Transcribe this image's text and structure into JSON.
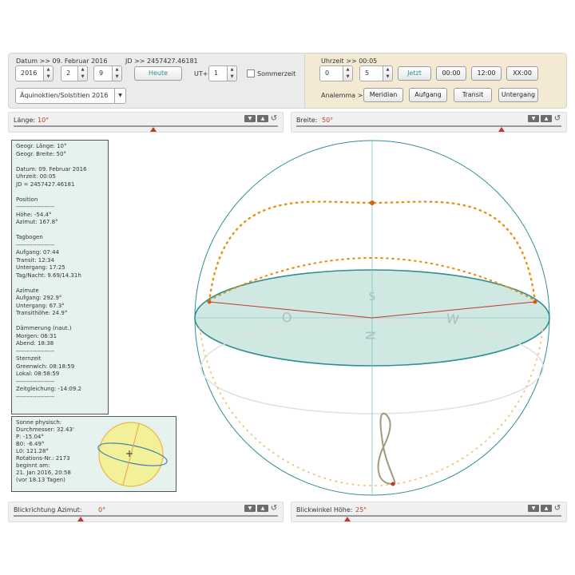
{
  "date_panel": {
    "datum_label": "Datum >> 09. Februar 2016",
    "jd_label": "JD >> 2457427.46181",
    "year": "2016",
    "month": "2",
    "day": "9",
    "today_button": "Heute",
    "ut_label": "UT+",
    "ut_value": "1",
    "dst_label": "Sommerzeit",
    "event_select": "Äquinoktien/Solstitien 2016"
  },
  "time_panel": {
    "time_label": "Uhrzeit >> 00:05",
    "hour": "0",
    "minute": "5",
    "now_button": "Jetzt",
    "preset_0000": "00:00",
    "preset_1200": "12:00",
    "preset_xx": "XX:00",
    "analemma_label": "Analemma >>",
    "meridian": "Meridian",
    "aufgang": "Aufgang",
    "transit": "Transit",
    "untergang": "Untergang"
  },
  "sliders": {
    "laenge_label": "Länge:",
    "laenge_value": "10°",
    "breite_label": "Breite:",
    "breite_value": "50°",
    "azimut_label": "Blickrichtung Azimut:",
    "azimut_value": "0°",
    "hoehe_label": "Blickwinkel Höhe:",
    "hoehe_value": "25°"
  },
  "info_lines": [
    "Geogr. Länge: 10°",
    "Geogr. Breite: 50°",
    "",
    "Datum: 09. Februar 2016",
    "Uhrzeit: 00:05",
    "JD = 2457427.46181",
    "",
    "Position",
    "-------------------",
    " Höhe: -54.4°",
    " Azimut: 167.8°",
    "",
    "Tagbogen",
    "-------------------",
    " Aufgang: 07:44",
    " Transit: 12:34",
    " Untergang: 17:25",
    " Tag/Nacht: 9.69/14.31h",
    "",
    "Azimute",
    " Aufgang: 292.9°",
    " Untergang: 67.3°",
    " Transithöhe: 24.9°",
    "",
    "Dämmerung (naut.)",
    " Morgen: 06:31",
    " Abend: 18:38",
    "-------------------",
    "Sternzeit",
    " Greenwich: 08:18:59",
    " Lokal: 08:58:59",
    "-------------------",
    "Zeitgleichung: -14:09.2",
    "-------------------"
  ],
  "sun_lines": [
    "Sonne physisch:",
    " Durchmesser: 32.43'",
    " P: -15.04°",
    " B0: -6.49°",
    " L0: 121.28°",
    " Rotations-Nr.: 2173",
    " beginnt am:",
    " 21. Jan 2016, 20:58",
    " (vor 18.13 Tagen)"
  ],
  "compass": {
    "s": "S",
    "o": "O",
    "n": "N",
    "w": "W"
  },
  "colors": {
    "teal": "#2f8f95",
    "orange": "#e8920f",
    "red": "#c0392b",
    "horizon_fill": "#cce9e2"
  }
}
